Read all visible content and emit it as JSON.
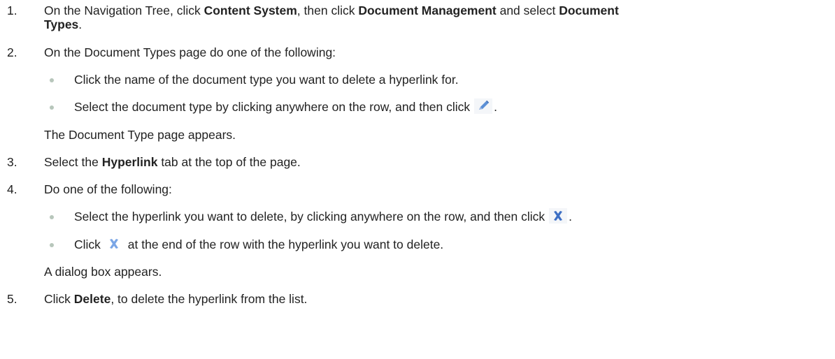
{
  "steps": [
    {
      "number": "1.",
      "text_before": "On the Navigation Tree, click ",
      "content_system": "Content System",
      "text_middle": ", then click ",
      "document_management": "Document Management",
      "text_and_select": " and select ",
      "document": "Document",
      "types": "Types",
      "period": "."
    },
    {
      "number": "2.",
      "text": "On the Document Types page do one of the following:",
      "options": [
        {
          "text": "Click the name of the document type you want to delete a hyperlink for."
        },
        {
          "text_before": "Select the document type by clicking anywhere on the row, and then click",
          "icon": "edit-pencil-icon",
          "text_after": "."
        }
      ],
      "result": "The Document Type page appears."
    },
    {
      "number": "3.",
      "text_before": "Select the ",
      "hyperlink": "Hyperlink",
      "text_after": " tab at the top of the page."
    },
    {
      "number": "4.",
      "text": "Do one of the following:",
      "options": [
        {
          "text_before": "Select the hyperlink you want to delete, by clicking anywhere on the row, and then click",
          "icon": "delete-x-icon",
          "text_after": "."
        },
        {
          "text_before": "Click",
          "icon": "delete-x-icon",
          "text_after": " at the end of the row with the hyperlink you want to delete."
        }
      ],
      "result": "A dialog box appears."
    },
    {
      "number": "5.",
      "text_before": "Click ",
      "delete": "Delete",
      "text_after": ", to delete the hyperlink from the list."
    }
  ],
  "colors": {
    "icon_blue": "#5b8fd6",
    "bullet": "#b7c6bb",
    "text": "#222222"
  }
}
